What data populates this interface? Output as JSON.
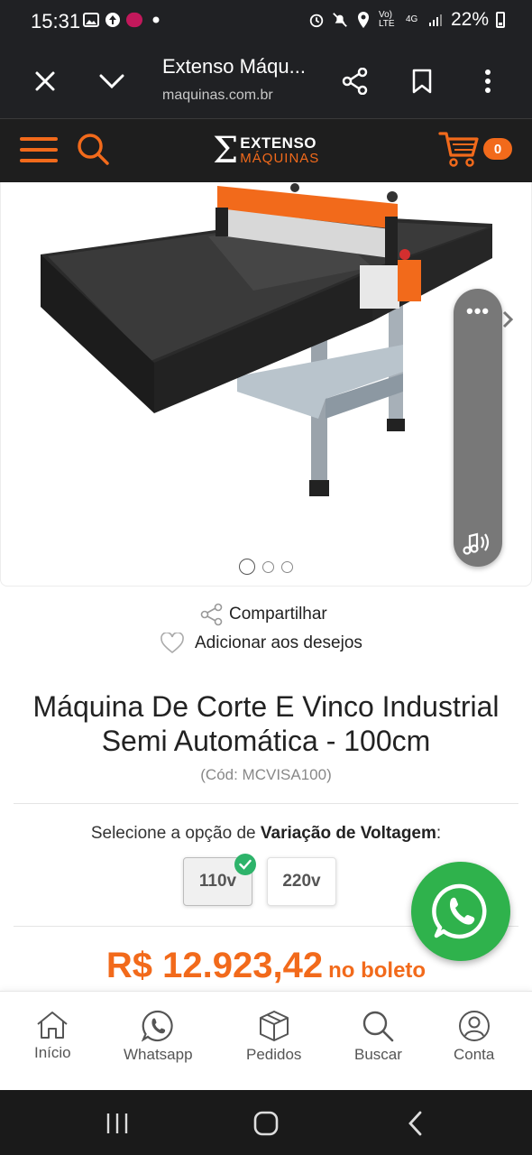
{
  "status_bar": {
    "time": "15:31",
    "battery": "22%",
    "volte_label": "Vo) LTE",
    "network_label": "4G"
  },
  "browser": {
    "title": "Extenso Máqu...",
    "url": "maquinas.com.br"
  },
  "site_header": {
    "logo_top": "EXTENSO",
    "logo_bottom": "MÁQUINAS",
    "cart_count": "0",
    "accent_color": "#f26a1b"
  },
  "product": {
    "share_label": "Compartilhar",
    "wishlist_label": "Adicionar aos desejos",
    "title_line1": "Máquina De Corte E Vinco Industrial",
    "title_line2": "Semi Automática - 100cm",
    "code": "(Cód: MCVISA100)",
    "variation_prefix": "Selecione a opção de ",
    "variation_name": "Variação de Voltagem",
    "variation_suffix": ":",
    "options": [
      "110v",
      "220v"
    ],
    "selected_option": "110v",
    "price": "R$ 12.923,42",
    "price_suffix": "no boleto",
    "image_count": 3,
    "active_image_index": 0
  },
  "bottom_nav": {
    "items": [
      "Início",
      "Whatsapp",
      "Pedidos",
      "Buscar",
      "Conta"
    ]
  }
}
